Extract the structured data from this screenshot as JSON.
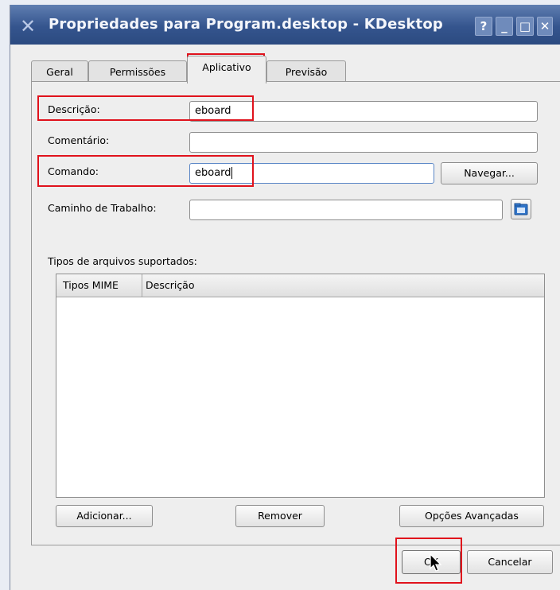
{
  "window": {
    "title": "Propriedades para Program.desktop - KDesktop",
    "help_btn": "?",
    "minimize_btn": "_",
    "maximize_btn": "□",
    "close_btn": "✕"
  },
  "tabs": [
    {
      "label": "Geral",
      "active": false
    },
    {
      "label": "Permissões",
      "active": false
    },
    {
      "label": "Aplicativo",
      "active": true
    },
    {
      "label": "Previsão",
      "active": false
    }
  ],
  "form": {
    "descricao_label": "Descrição:",
    "descricao_value": "eboard",
    "comentario_label": "Comentário:",
    "comentario_value": "",
    "comando_label": "Comando:",
    "comando_value": "eboard",
    "navegar_button": "Navegar...",
    "caminho_label": "Caminho de Trabalho:",
    "caminho_value": ""
  },
  "mime": {
    "section_label": "Tipos de arquivos suportados:",
    "columns": [
      "Tipos MIME",
      "Descrição"
    ]
  },
  "actions": {
    "adicionar": "Adicionar...",
    "remover": "Remover",
    "opcoes": "Opções Avançadas"
  },
  "footer": {
    "ok": "OK",
    "cancelar": "Cancelar"
  },
  "colors": {
    "highlight_red": "#e0121c",
    "titlebar_blue": "#35558e"
  }
}
